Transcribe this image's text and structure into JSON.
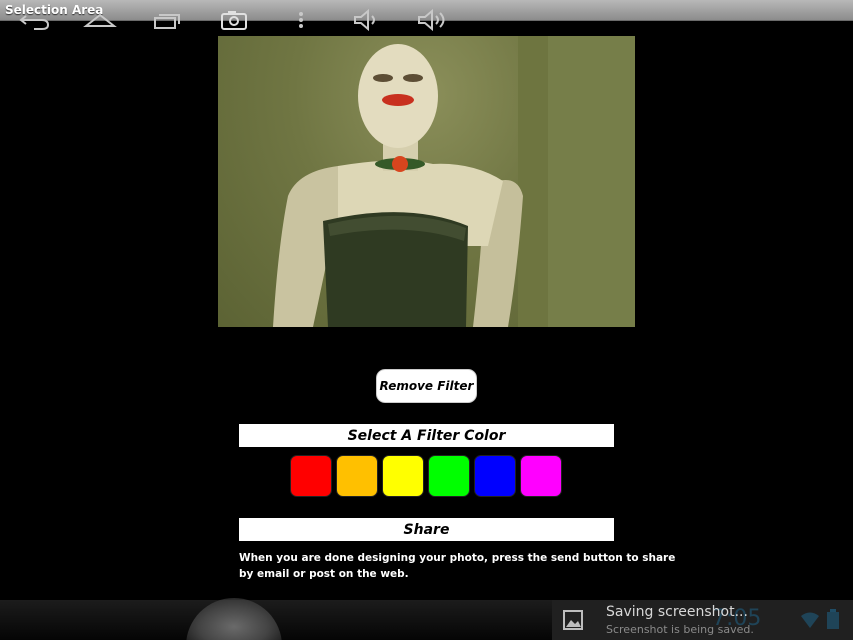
{
  "window": {
    "title": "Selection Area"
  },
  "photo": {
    "subject": "photo-preview"
  },
  "buttons": {
    "remove_filter": "Remove Filter"
  },
  "filter_section": {
    "title": "Select A Filter Color",
    "colors": [
      "#ff0000",
      "#ffc000",
      "#ffff00",
      "#00ff00",
      "#0000ff",
      "#ff00ff"
    ]
  },
  "share_section": {
    "title": "Share",
    "line1": "When you are done designing your photo, press the send button to share",
    "line2": " by email or post on the web."
  },
  "notification": {
    "title": "Saving screenshot...",
    "subtitle": "Screenshot is being saved.",
    "clock": "7:05"
  },
  "navbar": {
    "icons": [
      "back-icon",
      "home-icon",
      "recent-apps-icon",
      "camera-icon",
      "menu-icon",
      "volume-down-icon",
      "volume-up-icon",
      "image-icon",
      "wifi-icon",
      "battery-icon"
    ]
  }
}
